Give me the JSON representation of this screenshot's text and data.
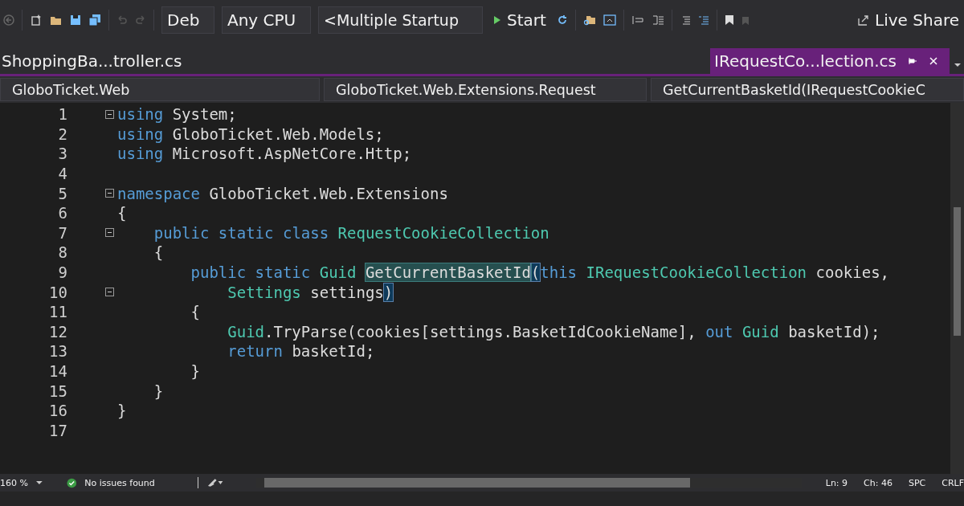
{
  "toolbar": {
    "configuration": "Deb",
    "platform": "Any CPU",
    "startup": "<Multiple Startup",
    "start": "Start",
    "live_share": "Live Share"
  },
  "tabs": [
    {
      "label": "ShoppingBa...troller.cs",
      "selected": false
    },
    {
      "label": "IRequestCo...lection.cs",
      "selected": true
    }
  ],
  "navigation_bar": [
    "GloboTicket.Web",
    "GloboTicket.Web.Extensions.Request",
    "GetCurrentBasketId(IRequestCookieC"
  ],
  "code_lines": [
    {
      "number": "1",
      "fold_marker": true,
      "tokens": [
        {
          "kind": "kw",
          "text": "using"
        },
        {
          "kind": "plain",
          "text": " System;"
        }
      ]
    },
    {
      "number": "2",
      "fold_marker": false,
      "tokens": [
        {
          "kind": "kw",
          "text": "using"
        },
        {
          "kind": "plain",
          "text": " GloboTicket.Web.Models;"
        }
      ]
    },
    {
      "number": "3",
      "fold_marker": false,
      "tokens": [
        {
          "kind": "kw",
          "text": "using"
        },
        {
          "kind": "plain",
          "text": " Microsoft.AspNetCore.Http;"
        }
      ]
    },
    {
      "number": "4",
      "fold_marker": false
    },
    {
      "number": "5",
      "fold_marker": true,
      "tokens": [
        {
          "kind": "kw",
          "text": "namespace"
        },
        {
          "kind": "plain",
          "text": " GloboTicket.Web.Extensions"
        }
      ]
    },
    {
      "number": "6",
      "fold_marker": false,
      "tokens": [
        {
          "kind": "plain",
          "text": "{"
        }
      ]
    },
    {
      "number": "7",
      "fold_marker": true,
      "tokens": [
        {
          "kind": "kw",
          "text": "    public "
        },
        {
          "kind": "kw",
          "text": "static "
        },
        {
          "kind": "kw",
          "text": "class "
        },
        {
          "kind": "type",
          "text": "RequestCookieCollection"
        }
      ]
    },
    {
      "number": "8",
      "fold_marker": false,
      "tokens": [
        {
          "kind": "plain",
          "text": "    {"
        }
      ]
    },
    {
      "number": "9",
      "fold_marker": false,
      "tokens": [
        {
          "kind": "kw",
          "text": "        public "
        },
        {
          "kind": "kw",
          "text": "static "
        },
        {
          "kind": "type",
          "text": "Guid "
        },
        {
          "kind": "selected",
          "text": "GetCurrentBasketId"
        },
        {
          "kind": "match",
          "text": "("
        },
        {
          "kind": "kw",
          "text": "this "
        },
        {
          "kind": "type",
          "text": "IRequestCookieCollection"
        },
        {
          "kind": "plain",
          "text": " cookies,"
        }
      ]
    },
    {
      "number": "10",
      "fold_marker": true,
      "tokens": [
        {
          "kind": "type",
          "text": "            Settings"
        },
        {
          "kind": "plain",
          "text": " settings"
        },
        {
          "kind": "match",
          "text": ")"
        }
      ]
    },
    {
      "number": "11",
      "fold_marker": false,
      "tokens": [
        {
          "kind": "plain",
          "text": "        {"
        }
      ]
    },
    {
      "number": "12",
      "fold_marker": false,
      "tokens": [
        {
          "kind": "type",
          "text": "            Guid"
        },
        {
          "kind": "plain",
          "text": ".TryParse(cookies[settings.BasketIdCookieName], "
        },
        {
          "kind": "kw",
          "text": "out "
        },
        {
          "kind": "type",
          "text": "Guid"
        },
        {
          "kind": "plain",
          "text": " basketId);"
        }
      ]
    },
    {
      "number": "13",
      "fold_marker": false,
      "tokens": [
        {
          "kind": "kw",
          "text": "            return"
        },
        {
          "kind": "plain",
          "text": " basketId;"
        }
      ]
    },
    {
      "number": "14",
      "fold_marker": false,
      "tokens": [
        {
          "kind": "plain",
          "text": "        }"
        }
      ]
    },
    {
      "number": "15",
      "fold_marker": false,
      "tokens": [
        {
          "kind": "plain",
          "text": "    }"
        }
      ]
    },
    {
      "number": "16",
      "fold_marker": false,
      "tokens": [
        {
          "kind": "plain",
          "text": "}"
        }
      ]
    },
    {
      "number": "17",
      "fold_marker": false
    }
  ],
  "status_bar": {
    "zoom": "160 %",
    "issues": "No issues found",
    "line": "Ln: 9",
    "column": "Ch: 46",
    "whitespace": "SPC",
    "line_endings": "CRLF"
  }
}
